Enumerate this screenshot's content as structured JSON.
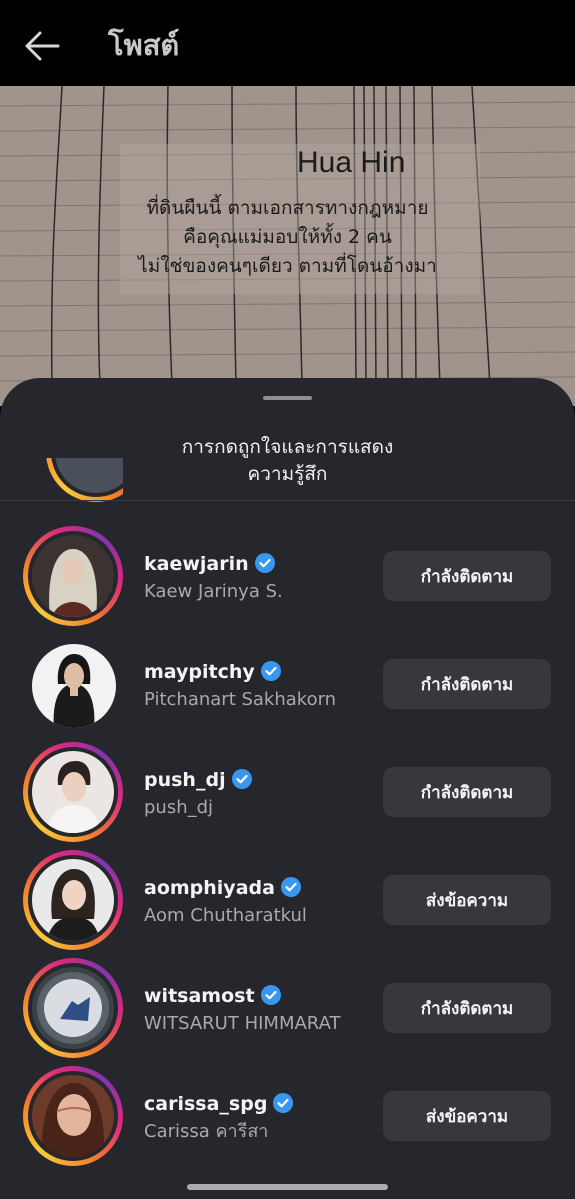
{
  "header": {
    "title": "โพสต์"
  },
  "post_image": {
    "place": "Hua Hin",
    "lines": [
      "ที่ดินผืนนี้ ตามเอกสารทางกฎหมาย",
      "คือคุณแม่มอบให้ทั้ง 2 คน",
      "ไม่ใช่ของคนๆเดียว ตามที่โดนอ้างมา"
    ]
  },
  "sheet": {
    "title_line1": "การกดถูกใจและการแสดง",
    "title_line2": "ความรู้สึก",
    "users": [
      {
        "username": "kaewjarin",
        "full_name": "Kaew Jarinya S.",
        "button": "กำลังติดตาม",
        "story_ring": true
      },
      {
        "username": "maypitchy",
        "full_name": "Pitchanart Sakhakorn",
        "button": "กำลังติดตาม",
        "story_ring": false
      },
      {
        "username": "push_dj",
        "full_name": "push_dj",
        "button": "กำลังติดตาม",
        "story_ring": true
      },
      {
        "username": "aomphiyada",
        "full_name": "Aom Chutharatkul",
        "button": "ส่งข้อความ",
        "story_ring": true
      },
      {
        "username": "witsamost",
        "full_name": "WITSARUT HIMMARAT",
        "button": "กำลังติดตาม",
        "story_ring": true
      },
      {
        "username": "carissa_spg",
        "full_name": "Carissa คารีสา",
        "button": "ส่งข้อความ",
        "story_ring": true
      }
    ]
  },
  "colors": {
    "sheet_bg": "#25272c",
    "button_bg": "#36383d",
    "verified": "#3897f0"
  }
}
